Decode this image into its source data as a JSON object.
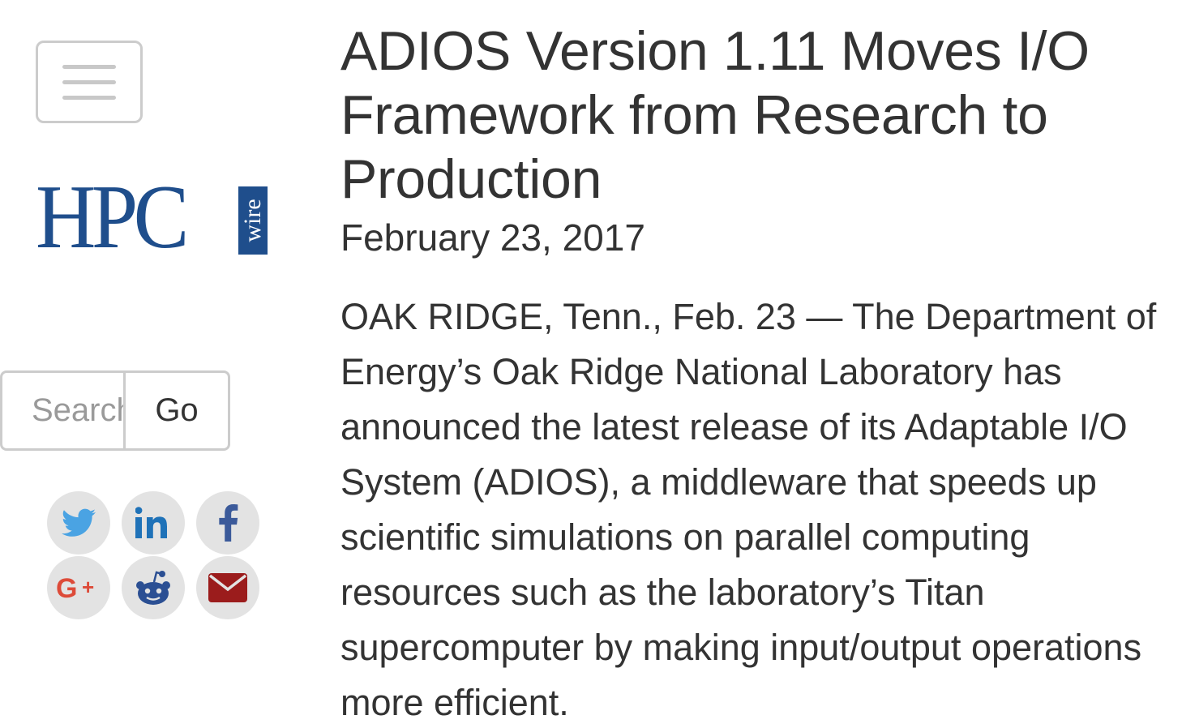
{
  "sidebar": {
    "logo": {
      "main": "HPC",
      "tag": "wire"
    },
    "search": {
      "placeholder": "Search",
      "value": "",
      "button_label": "Go"
    },
    "social": [
      {
        "name": "twitter",
        "color": "#4aa3e3"
      },
      {
        "name": "linkedin",
        "color": "#1f72b8"
      },
      {
        "name": "facebook",
        "color": "#3b5a9a"
      },
      {
        "name": "google-plus",
        "color": "#dd4b39"
      },
      {
        "name": "reddit",
        "color": "#2b4f93"
      },
      {
        "name": "email",
        "color": "#9b1c1c"
      }
    ]
  },
  "article": {
    "title": "ADIOS Version 1.11 Moves I/O Framework from Research to Production",
    "date": "February 23, 2017",
    "body": "OAK RIDGE, Tenn., Feb. 23 — The Department of Energy’s Oak Ridge National Laboratory has announced the latest release of its Adaptable I/O System (ADIOS), a middleware that speeds up scientific simulations on parallel computing resources such as the laboratory’s Titan supercomputer by making input/output operations more efficient."
  },
  "colors": {
    "brand": "#1f4e8c",
    "text": "#333333",
    "border": "#cccccc",
    "icon_bg": "#e3e3e3"
  }
}
